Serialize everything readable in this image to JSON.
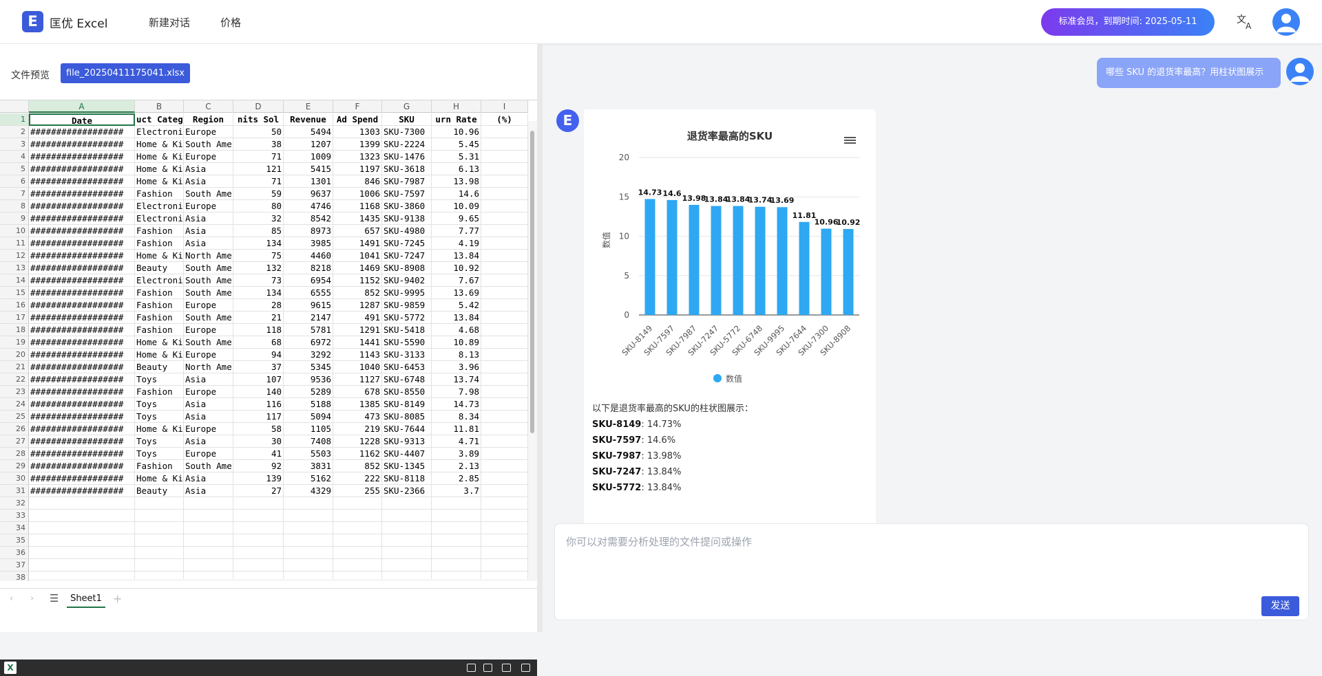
{
  "brand": {
    "logo_letter": "E",
    "name": "匡优 Excel"
  },
  "nav": [
    "新建对话",
    "价格"
  ],
  "member": "标准会员，到期时间: 2025-05-11",
  "file_preview": {
    "label": "文件预览",
    "file": "file_20250411175041.xlsx"
  },
  "sheet": {
    "columns": [
      "A",
      "B",
      "C",
      "D",
      "E",
      "F",
      "G",
      "H",
      "I"
    ],
    "row_numbers": [
      "1",
      "2",
      "3",
      "4",
      "5",
      "6",
      "7",
      "8",
      "9",
      "10",
      "11",
      "12",
      "13",
      "14",
      "15",
      "16",
      "17",
      "18",
      "19",
      "20",
      "21",
      "22",
      "23",
      "24",
      "25",
      "26",
      "27",
      "28",
      "29",
      "30",
      "31",
      "32",
      "33",
      "34",
      "35",
      "36",
      "37",
      "38"
    ],
    "header": [
      "Date",
      "uct Categ",
      "Region",
      "nits Sol",
      "Revenue",
      "Ad Spend",
      "SKU",
      "urn Rate",
      "(%)"
    ],
    "rows": [
      [
        "##################",
        "Electroni",
        "Europe",
        "50",
        "5494",
        "1303",
        "SKU-7300",
        "10.96"
      ],
      [
        "##################",
        "Home & Ki",
        "South Ame",
        "38",
        "1207",
        "1399",
        "SKU-2224",
        "5.45"
      ],
      [
        "##################",
        "Home & Ki",
        "Europe",
        "71",
        "1009",
        "1323",
        "SKU-1476",
        "5.31"
      ],
      [
        "##################",
        "Home & Ki",
        "Asia",
        "121",
        "5415",
        "1197",
        "SKU-3618",
        "6.13"
      ],
      [
        "##################",
        "Home & Ki",
        "Asia",
        "71",
        "1301",
        "846",
        "SKU-7987",
        "13.98"
      ],
      [
        "##################",
        "Fashion",
        "South Ame",
        "59",
        "9637",
        "1006",
        "SKU-7597",
        "14.6"
      ],
      [
        "##################",
        "Electroni",
        "Europe",
        "80",
        "4746",
        "1168",
        "SKU-3860",
        "10.09"
      ],
      [
        "##################",
        "Electroni",
        "Asia",
        "32",
        "8542",
        "1435",
        "SKU-9138",
        "9.65"
      ],
      [
        "##################",
        "Fashion",
        "Asia",
        "85",
        "8973",
        "657",
        "SKU-4980",
        "7.77"
      ],
      [
        "##################",
        "Fashion",
        "Asia",
        "134",
        "3985",
        "1491",
        "SKU-7245",
        "4.19"
      ],
      [
        "##################",
        "Home & Ki",
        "North Ame",
        "75",
        "4460",
        "1041",
        "SKU-7247",
        "13.84"
      ],
      [
        "##################",
        "Beauty",
        "South Ame",
        "132",
        "8218",
        "1469",
        "SKU-8908",
        "10.92"
      ],
      [
        "##################",
        "Electroni",
        "South Ame",
        "73",
        "6954",
        "1152",
        "SKU-9402",
        "7.67"
      ],
      [
        "##################",
        "Fashion",
        "South Ame",
        "134",
        "6555",
        "852",
        "SKU-9995",
        "13.69"
      ],
      [
        "##################",
        "Fashion",
        "Europe",
        "28",
        "9615",
        "1287",
        "SKU-9859",
        "5.42"
      ],
      [
        "##################",
        "Fashion",
        "South Ame",
        "21",
        "2147",
        "491",
        "SKU-5772",
        "13.84"
      ],
      [
        "##################",
        "Fashion",
        "Europe",
        "118",
        "5781",
        "1291",
        "SKU-5418",
        "4.68"
      ],
      [
        "##################",
        "Home & Ki",
        "South Ame",
        "68",
        "6972",
        "1441",
        "SKU-5590",
        "10.89"
      ],
      [
        "##################",
        "Home & Ki",
        "Europe",
        "94",
        "3292",
        "1143",
        "SKU-3133",
        "8.13"
      ],
      [
        "##################",
        "Beauty",
        "North Ame",
        "37",
        "5345",
        "1040",
        "SKU-6453",
        "3.96"
      ],
      [
        "##################",
        "Toys",
        "Asia",
        "107",
        "9536",
        "1127",
        "SKU-6748",
        "13.74"
      ],
      [
        "##################",
        "Fashion",
        "Europe",
        "140",
        "5289",
        "678",
        "SKU-8550",
        "7.98"
      ],
      [
        "##################",
        "Toys",
        "Asia",
        "116",
        "5188",
        "1385",
        "SKU-8149",
        "14.73"
      ],
      [
        "##################",
        "Toys",
        "Asia",
        "117",
        "5094",
        "473",
        "SKU-8085",
        "8.34"
      ],
      [
        "##################",
        "Home & Ki",
        "Europe",
        "58",
        "1105",
        "219",
        "SKU-7644",
        "11.81"
      ],
      [
        "##################",
        "Toys",
        "Asia",
        "30",
        "7408",
        "1228",
        "SKU-9313",
        "4.71"
      ],
      [
        "##################",
        "Toys",
        "Europe",
        "41",
        "5503",
        "1162",
        "SKU-4407",
        "3.89"
      ],
      [
        "##################",
        "Fashion",
        "South Ame",
        "92",
        "3831",
        "852",
        "SKU-1345",
        "2.13"
      ],
      [
        "##################",
        "Home & Ki",
        "Asia",
        "139",
        "5162",
        "222",
        "SKU-8118",
        "2.85"
      ],
      [
        "##################",
        "Beauty",
        "Asia",
        "27",
        "4329",
        "255",
        "SKU-2366",
        "3.7"
      ]
    ],
    "tab": "Sheet1"
  },
  "chat": {
    "user_message": "哪些 SKU 的退货率最高？用柱状图展示",
    "ai_logo_letter": "E",
    "summary_intro": "以下是退货率最高的SKU的柱状图展示：",
    "summary_items": [
      {
        "sku": "SKU-8149",
        "value": ": 14.73%"
      },
      {
        "sku": "SKU-7597",
        "value": ": 14.6%"
      },
      {
        "sku": "SKU-7987",
        "value": ": 13.98%"
      },
      {
        "sku": "SKU-7247",
        "value": ": 13.84%"
      },
      {
        "sku": "SKU-5772",
        "value": ": 13.84%"
      }
    ],
    "input_placeholder": "你可以对需要分析处理的文件提问或操作",
    "send_label": "发送"
  },
  "chart_data": {
    "type": "bar",
    "title": "退货率最高的SKU",
    "ylabel": "数值",
    "ylim": [
      0,
      20
    ],
    "yticks": [
      0,
      5,
      10,
      15,
      20
    ],
    "categories": [
      "SKU-8149",
      "SKU-7597",
      "SKU-7987",
      "SKU-7247",
      "SKU-5772",
      "SKU-6748",
      "SKU-9995",
      "SKU-7644",
      "SKU-7300",
      "SKU-8908"
    ],
    "series": [
      {
        "name": "数值",
        "values": [
          14.73,
          14.6,
          13.98,
          13.84,
          13.84,
          13.74,
          13.69,
          11.81,
          10.96,
          10.92
        ]
      }
    ],
    "legend": "bottom",
    "grid": true,
    "bar_color": "#2ea8f2"
  }
}
